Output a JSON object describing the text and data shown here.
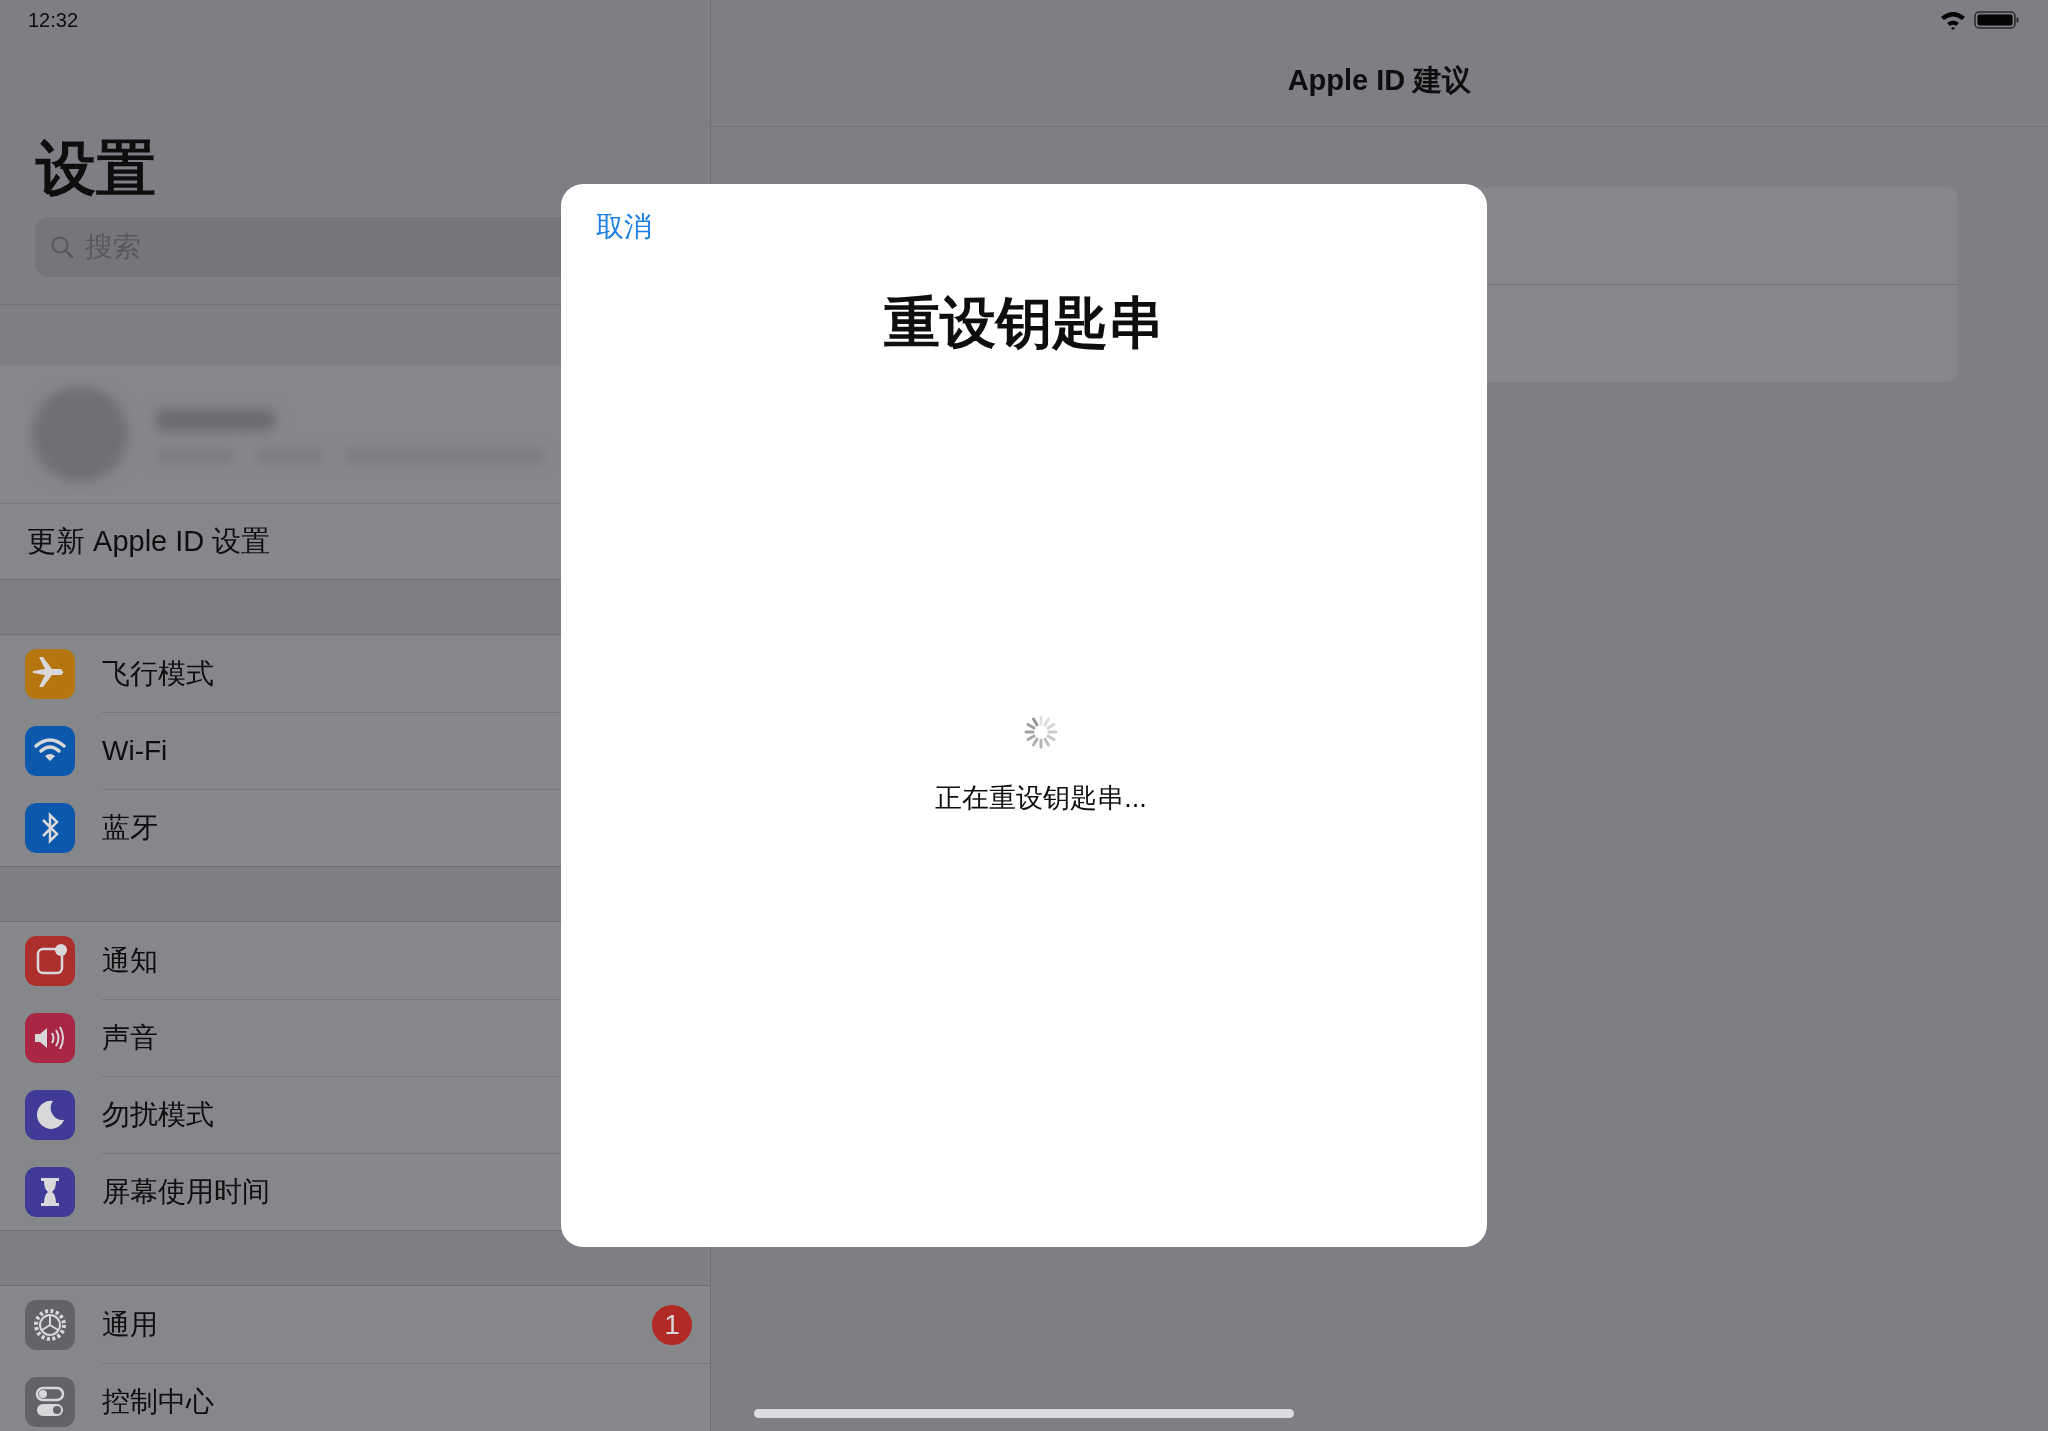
{
  "status_bar": {
    "time": "12:32"
  },
  "sidebar": {
    "title": "设置",
    "search": {
      "placeholder": "搜索"
    },
    "apple_id_row": {
      "label": "更新 Apple ID 设置"
    },
    "groups": [
      {
        "items": [
          {
            "label": "飞行模式",
            "kind": "airplane",
            "color": "#b5760f"
          },
          {
            "label": "Wi-Fi",
            "kind": "wifi",
            "color": "#0c58ad"
          },
          {
            "label": "蓝牙",
            "kind": "bluetooth",
            "color": "#0c58ad"
          }
        ]
      },
      {
        "items": [
          {
            "label": "通知",
            "kind": "notifications",
            "color": "#ad2f2b"
          },
          {
            "label": "声音",
            "kind": "sound",
            "color": "#a92644"
          },
          {
            "label": "勿扰模式",
            "kind": "moon",
            "color": "#3f3b97"
          },
          {
            "label": "屏幕使用时间",
            "kind": "hourglass",
            "color": "#3f3b97"
          }
        ]
      },
      {
        "items": [
          {
            "label": "通用",
            "kind": "gear",
            "color": "#626367",
            "badge": "1"
          },
          {
            "label": "控制中心",
            "kind": "toggles",
            "color": "#626367"
          }
        ]
      }
    ]
  },
  "detail": {
    "title": "Apple ID 建议"
  },
  "modal": {
    "cancel": "取消",
    "title": "重设钥匙串",
    "status": "正在重设钥匙串..."
  }
}
